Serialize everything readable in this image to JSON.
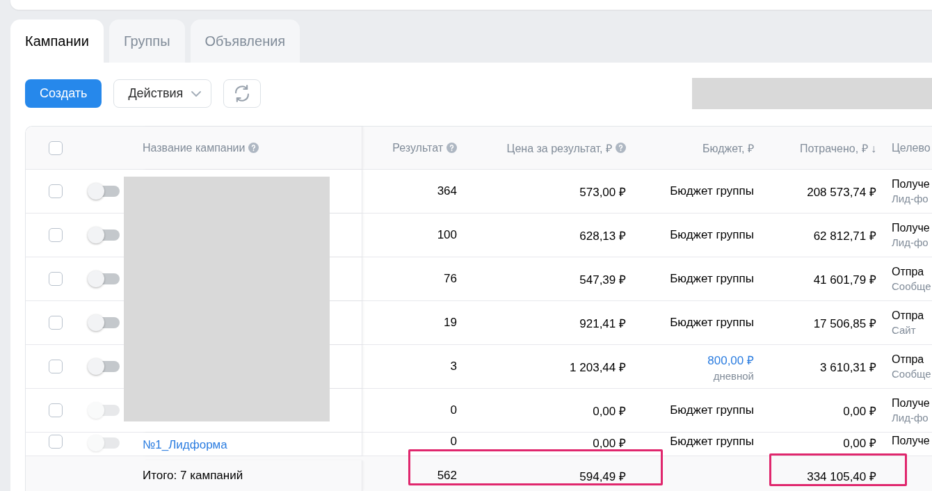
{
  "tabs": [
    {
      "label": "Кампании",
      "selected": true
    },
    {
      "label": "Группы",
      "selected": false
    },
    {
      "label": "Объявления",
      "selected": false
    }
  ],
  "toolbar": {
    "create_button": "Создать",
    "actions_button": "Действия"
  },
  "table": {
    "select_all": {
      "checked": false
    },
    "columns": [
      {
        "label": "Название кампании",
        "help": true
      },
      {
        "label": "Результат",
        "help": true
      },
      {
        "label": "Цена за результат, ₽",
        "help": true
      },
      {
        "label": "Бюджет, ₽",
        "help": false
      },
      {
        "label": "Потрачено, ₽ ↓",
        "help": false
      },
      {
        "label": "Целево",
        "help": false
      }
    ],
    "rows": [
      {
        "checked": false,
        "toggle": {
          "on": false,
          "disabled": false
        },
        "result": "364",
        "price": "573,00 ₽",
        "budget": {
          "kind": "text",
          "text": "Бюджет группы"
        },
        "spent": "208 573,74 ₽",
        "target": {
          "title": "Получе",
          "subtitle": "Лид-фо"
        }
      },
      {
        "checked": false,
        "toggle": {
          "on": false,
          "disabled": false
        },
        "result": "100",
        "price": "628,13 ₽",
        "budget": {
          "kind": "text",
          "text": "Бюджет группы"
        },
        "spent": "62 812,71 ₽",
        "target": {
          "title": "Получе",
          "subtitle": "Лид-фо"
        }
      },
      {
        "checked": false,
        "toggle": {
          "on": false,
          "disabled": false
        },
        "result": "76",
        "price": "547,39 ₽",
        "budget": {
          "kind": "text",
          "text": "Бюджет группы"
        },
        "spent": "41 601,79 ₽",
        "target": {
          "title": "Отпра",
          "subtitle": "Сообще"
        }
      },
      {
        "checked": false,
        "toggle": {
          "on": false,
          "disabled": false
        },
        "result": "19",
        "price": "921,41 ₽",
        "budget": {
          "kind": "text",
          "text": "Бюджет группы"
        },
        "spent": "17 506,85 ₽",
        "target": {
          "title": "Отпра",
          "subtitle": "Сайт"
        }
      },
      {
        "checked": false,
        "toggle": {
          "on": false,
          "disabled": false
        },
        "result": "3",
        "price": "1 203,44 ₽",
        "budget": {
          "kind": "daily",
          "text": "800,00 ₽",
          "note": "дневной"
        },
        "spent": "3 610,31 ₽",
        "target": {
          "title": "Отпра",
          "subtitle": "Сообще"
        }
      },
      {
        "checked": false,
        "toggle": {
          "on": false,
          "disabled": true
        },
        "result": "0",
        "price": "0,00 ₽",
        "budget": {
          "kind": "text",
          "text": "Бюджет группы"
        },
        "spent": "0,00 ₽",
        "target": {
          "title": "Получе",
          "subtitle": "Лид-фо"
        }
      },
      {
        "checked": false,
        "toggle": {
          "on": false,
          "disabled": true
        },
        "name": "№1_Лидформа",
        "result": "0",
        "price": "0,00 ₽",
        "budget": {
          "kind": "text",
          "text": "Бюджет группы"
        },
        "spent": "0,00 ₽",
        "target": {
          "title": "Получе"
        }
      }
    ],
    "footer": {
      "label": "Итого: 7 кампаний",
      "result": "562",
      "price": "594,49 ₽",
      "spent": "334 105,40 ₽"
    }
  }
}
